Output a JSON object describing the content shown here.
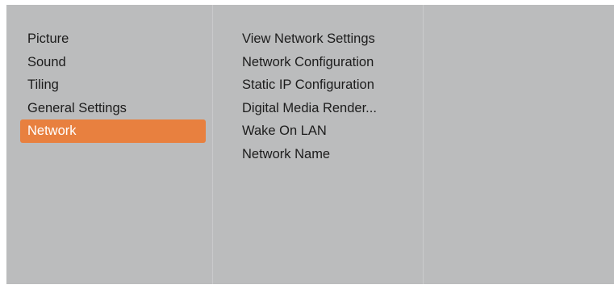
{
  "main_menu": {
    "items": [
      {
        "label": "Picture",
        "selected": false
      },
      {
        "label": "Sound",
        "selected": false
      },
      {
        "label": "Tiling",
        "selected": false
      },
      {
        "label": "General Settings",
        "selected": false
      },
      {
        "label": "Network",
        "selected": true
      }
    ]
  },
  "sub_menu": {
    "items": [
      {
        "label": "View Network Settings"
      },
      {
        "label": "Network Configuration"
      },
      {
        "label": "Static IP Configuration"
      },
      {
        "label": "Digital Media Render..."
      },
      {
        "label": "Wake On LAN"
      },
      {
        "label": "Network Name"
      }
    ]
  },
  "colors": {
    "panel_background": "#bbbcbd",
    "selected_highlight": "#e8803f",
    "text": "#1c1c1c",
    "selected_text": "#ffffff"
  }
}
